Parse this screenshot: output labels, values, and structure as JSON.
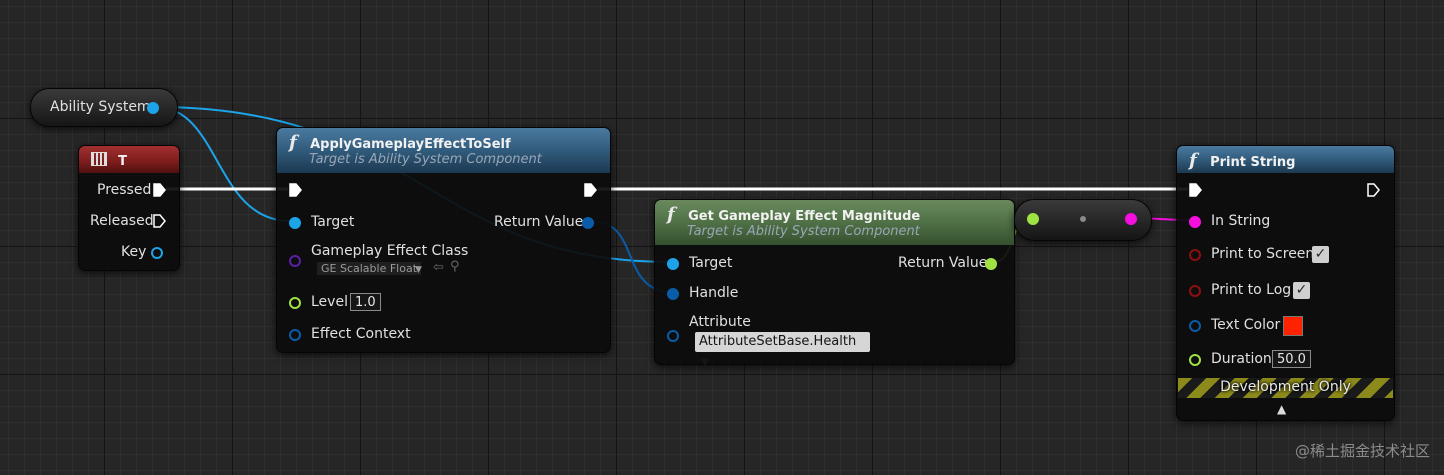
{
  "ability_system": {
    "label": "Ability System"
  },
  "key_t": {
    "title": "T",
    "pins": {
      "pressed": "Pressed",
      "released": "Released",
      "key": "Key"
    }
  },
  "apply_effect": {
    "title": "ApplyGameplayEffectToSelf",
    "subtitle": "Target is Ability System Component",
    "pins": {
      "target": "Target",
      "return_value": "Return Value",
      "effect_class": "Gameplay Effect Class",
      "effect_class_value": "GE Scalable Float",
      "level": "Level",
      "level_value": "1.0",
      "effect_context": "Effect Context"
    }
  },
  "get_magnitude": {
    "title": "Get Gameplay Effect Magnitude",
    "subtitle": "Target is Ability System Component",
    "pins": {
      "target": "Target",
      "return_value": "Return Value",
      "handle": "Handle",
      "attribute": "Attribute",
      "attribute_value": "AttributeSetBase.Health"
    }
  },
  "print_string": {
    "title": "Print String",
    "pins": {
      "in_string": "In String",
      "print_to_screen": "Print to Screen",
      "print_to_log": "Print to Log",
      "text_color": "Text Color",
      "duration": "Duration",
      "duration_value": "50.0"
    },
    "dev_only": "Development Only",
    "text_color_hex": "#ff2200",
    "print_to_screen_checked": true,
    "print_to_log_checked": true
  },
  "pin_colors": {
    "exec": "#ffffff",
    "object": "#1ca3e8",
    "struct": "#0a5ca8",
    "class": "#5c1fa8",
    "float": "#9ee342",
    "string": "#f50fdd",
    "bool": "#8e0f0f"
  },
  "watermark": "@稀土掘金技术社区"
}
